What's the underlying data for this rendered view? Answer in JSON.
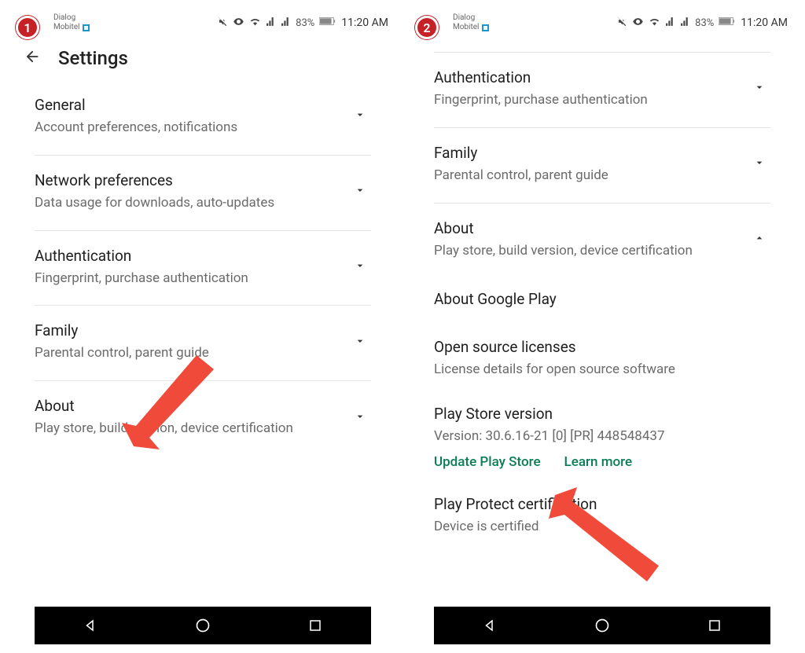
{
  "status": {
    "carrier1": "Dialog",
    "carrier2": "Mobitel",
    "battery": "83%",
    "time": "11:20 AM"
  },
  "screen1": {
    "title": "Settings",
    "items": [
      {
        "title": "General",
        "sub": "Account preferences, notifications"
      },
      {
        "title": "Network preferences",
        "sub": "Data usage for downloads, auto-updates"
      },
      {
        "title": "Authentication",
        "sub": "Fingerprint, purchase authentication"
      },
      {
        "title": "Family",
        "sub": "Parental control, parent guide"
      },
      {
        "title": "About",
        "sub": "Play store, build version, device certification"
      }
    ]
  },
  "screen2": {
    "items": [
      {
        "title": "Authentication",
        "sub": "Fingerprint, purchase authentication"
      },
      {
        "title": "Family",
        "sub": "Parental control, parent guide"
      },
      {
        "title": "About",
        "sub": "Play store, build version, device certification",
        "expanded": true
      }
    ],
    "about_sections": [
      {
        "title": "About Google Play",
        "sub": ""
      },
      {
        "title": "Open source licenses",
        "sub": "License details for open source software"
      },
      {
        "title": "Play Store version",
        "sub": "Version: 30.6.16-21 [0] [PR] 448548437",
        "links": [
          "Update Play Store",
          "Learn more"
        ]
      },
      {
        "title": "Play Protect certification",
        "sub": "Device is certified"
      }
    ]
  },
  "badges": {
    "b1": "1",
    "b2": "2"
  }
}
